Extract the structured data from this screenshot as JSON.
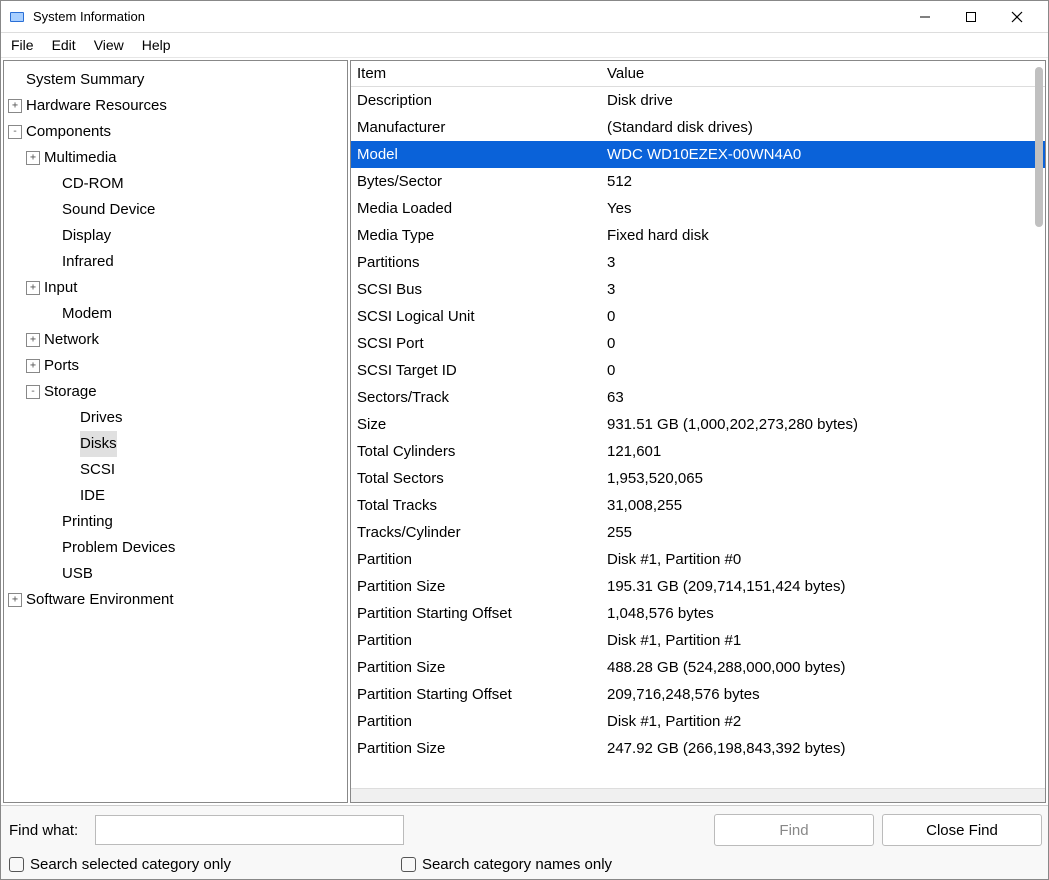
{
  "window": {
    "title": "System Information"
  },
  "menu": {
    "file": "File",
    "edit": "Edit",
    "view": "View",
    "help": "Help"
  },
  "tree": {
    "summary": "System Summary",
    "hardware": "Hardware Resources",
    "components": "Components",
    "multimedia": "Multimedia",
    "cdrom": "CD-ROM",
    "sound": "Sound Device",
    "display": "Display",
    "infrared": "Infrared",
    "input": "Input",
    "modem": "Modem",
    "network": "Network",
    "ports": "Ports",
    "storage": "Storage",
    "drives": "Drives",
    "disks": "Disks",
    "scsi": "SCSI",
    "ide": "IDE",
    "printing": "Printing",
    "problem": "Problem Devices",
    "usb": "USB",
    "software": "Software Environment"
  },
  "detail": {
    "header_item": "Item",
    "header_value": "Value",
    "rows": [
      {
        "item": "Description",
        "value": "Disk drive",
        "selected": false
      },
      {
        "item": "Manufacturer",
        "value": "(Standard disk drives)",
        "selected": false
      },
      {
        "item": "Model",
        "value": "WDC WD10EZEX-00WN4A0",
        "selected": true
      },
      {
        "item": "Bytes/Sector",
        "value": "512",
        "selected": false
      },
      {
        "item": "Media Loaded",
        "value": "Yes",
        "selected": false
      },
      {
        "item": "Media Type",
        "value": "Fixed hard disk",
        "selected": false
      },
      {
        "item": "Partitions",
        "value": "3",
        "selected": false
      },
      {
        "item": "SCSI Bus",
        "value": "3",
        "selected": false
      },
      {
        "item": "SCSI Logical Unit",
        "value": "0",
        "selected": false
      },
      {
        "item": "SCSI Port",
        "value": "0",
        "selected": false
      },
      {
        "item": "SCSI Target ID",
        "value": "0",
        "selected": false
      },
      {
        "item": "Sectors/Track",
        "value": "63",
        "selected": false
      },
      {
        "item": "Size",
        "value": "931.51 GB (1,000,202,273,280 bytes)",
        "selected": false
      },
      {
        "item": "Total Cylinders",
        "value": "121,601",
        "selected": false
      },
      {
        "item": "Total Sectors",
        "value": "1,953,520,065",
        "selected": false
      },
      {
        "item": "Total Tracks",
        "value": "31,008,255",
        "selected": false
      },
      {
        "item": "Tracks/Cylinder",
        "value": "255",
        "selected": false
      },
      {
        "item": "Partition",
        "value": "Disk #1, Partition #0",
        "selected": false
      },
      {
        "item": "Partition Size",
        "value": "195.31 GB (209,714,151,424 bytes)",
        "selected": false
      },
      {
        "item": "Partition Starting Offset",
        "value": "1,048,576 bytes",
        "selected": false
      },
      {
        "item": "Partition",
        "value": "Disk #1, Partition #1",
        "selected": false
      },
      {
        "item": "Partition Size",
        "value": "488.28 GB (524,288,000,000 bytes)",
        "selected": false
      },
      {
        "item": "Partition Starting Offset",
        "value": "209,716,248,576 bytes",
        "selected": false
      },
      {
        "item": "Partition",
        "value": "Disk #1, Partition #2",
        "selected": false
      },
      {
        "item": "Partition Size",
        "value": "247.92 GB (266,198,843,392 bytes)",
        "selected": false
      }
    ]
  },
  "footer": {
    "find_label": "Find what:",
    "find_value": "",
    "find_placeholder": "",
    "find_button": "Find",
    "close_button": "Close Find",
    "check_selected": "Search selected category only",
    "check_names": "Search category names only"
  },
  "twisty": {
    "plus": "+",
    "minus": "-"
  }
}
